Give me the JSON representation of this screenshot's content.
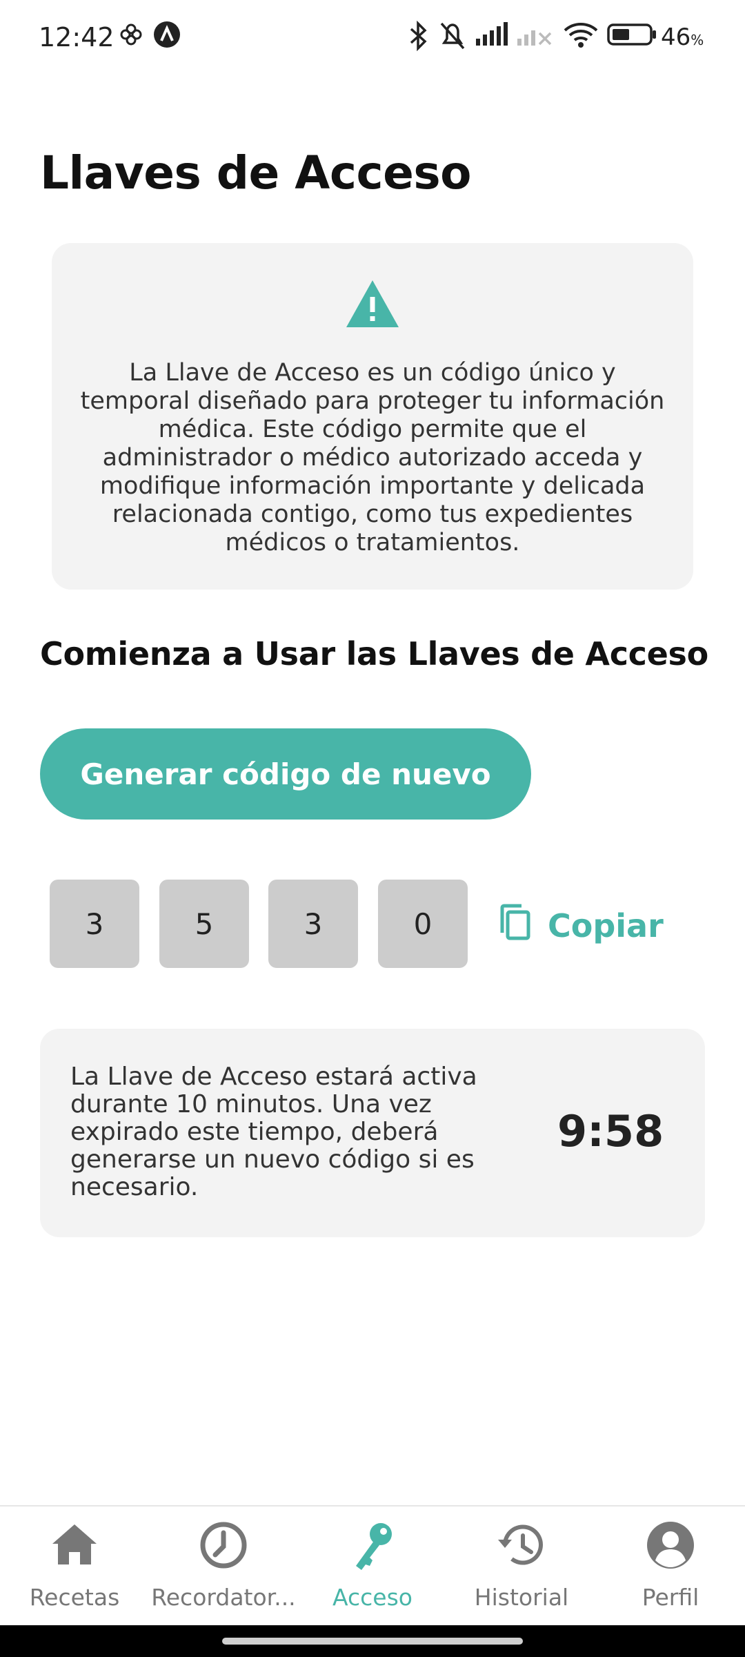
{
  "status_bar": {
    "time": "12:42",
    "battery": "46",
    "battery_unit": "%",
    "icons": [
      "pinwheel-icon",
      "app-a-icon",
      "bluetooth-icon",
      "bell-muted-icon",
      "signal-icon",
      "signal-off-icon",
      "wifi-icon",
      "battery-icon"
    ]
  },
  "page": {
    "title": "Llaves de Acceso"
  },
  "info_card": {
    "icon": "warning-icon",
    "text": "La Llave de Acceso es un código único y temporal diseñado para proteger tu información médica. Este código permite que el administrador o médico autorizado acceda y modifique información importante y delicada relacionada contigo, como tus expedientes médicos o tratamientos."
  },
  "section": {
    "title": "Comienza a Usar las Llaves de Acceso"
  },
  "generate_button": {
    "label": "Generar código de nuevo"
  },
  "code": {
    "digits": [
      "3",
      "5",
      "3",
      "0"
    ],
    "copy_label": "Copiar"
  },
  "timer_card": {
    "text": "La Llave de Acceso estará activa durante 10 minutos. Una vez expirado este tiempo, deberá generarse un nuevo código si es necesario.",
    "countdown": "9:58"
  },
  "bottom_nav": {
    "items": [
      {
        "label": "Recetas",
        "icon": "home-icon"
      },
      {
        "label": "Recordator...",
        "icon": "clock-icon"
      },
      {
        "label": "Acceso",
        "icon": "key-icon"
      },
      {
        "label": "Historial",
        "icon": "history-icon"
      },
      {
        "label": "Perfil",
        "icon": "profile-icon"
      }
    ],
    "active_index": 2
  },
  "colors": {
    "accent": "#48b5a8",
    "card_bg": "#f3f3f3",
    "digit_bg": "#cccccc"
  }
}
